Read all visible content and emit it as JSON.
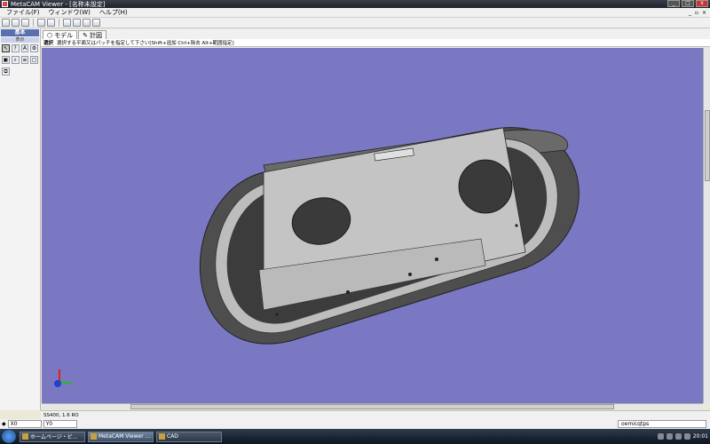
{
  "window": {
    "title": "MetaCAM Viewer - [名称未設定]"
  },
  "menu": {
    "items": [
      "ファイル(F)",
      "ウィンドウ(W)",
      "ヘルプ(H)"
    ]
  },
  "left_panel": {
    "header": "基本",
    "subheader": "表示"
  },
  "tabs": [
    {
      "label": "モデル"
    },
    {
      "label": "計図"
    }
  ],
  "hint": {
    "label": "選択",
    "text": "選択する平面又はパッチを指定して下さい[Shift+追加 Ctrl+除去 Alt+範囲指定]"
  },
  "status": {
    "text": "SS400, 1.6 RO"
  },
  "coords": {
    "x_label": "X0",
    "y_label": "Y0",
    "right_value": "oemicqtps"
  },
  "taskbar": {
    "items": [
      "ホームページ・ビ...",
      "MetaCAM Viewer ...",
      "CAD"
    ],
    "clock": "20:01"
  },
  "colors": {
    "viewport_bg": "#7a78c2",
    "part_body": "#c8c8c8",
    "part_dark": "#5a5a5a"
  }
}
